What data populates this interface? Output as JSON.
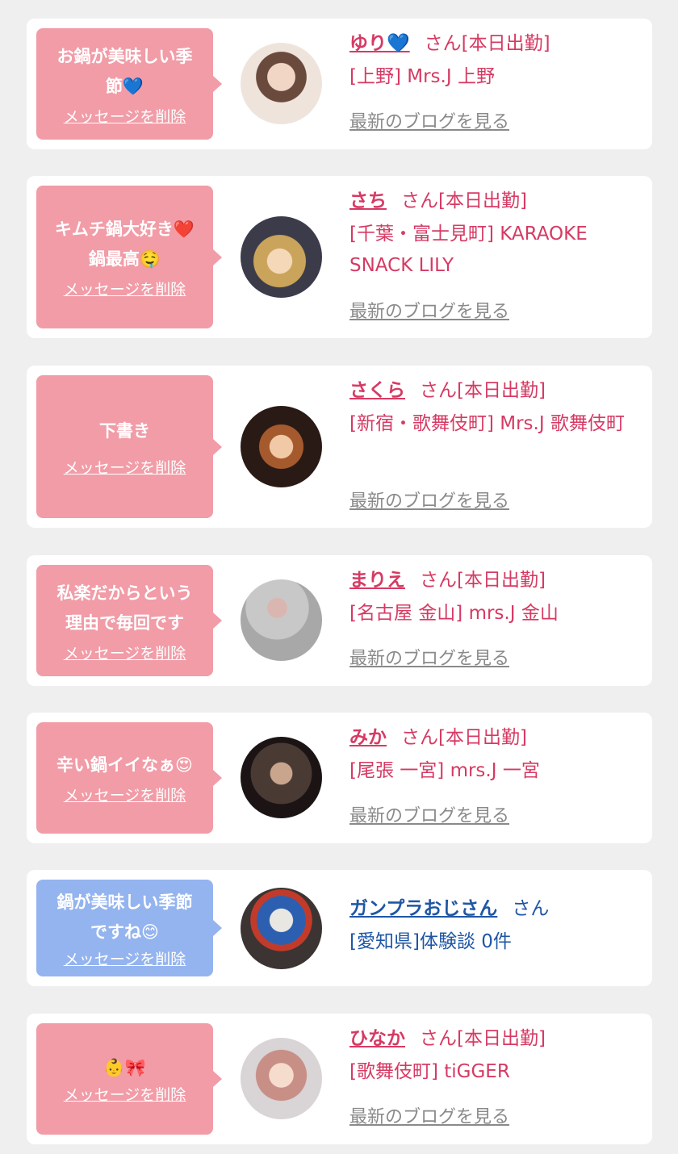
{
  "colors": {
    "pink": "#f19ca7",
    "blue": "#94b4ef",
    "name_pink": "#d63a63",
    "name_blue": "#1f56a5",
    "link_gray": "#8a8a8a"
  },
  "cards": [
    {
      "message": "お鍋が美味しい季\n節💙",
      "delete": "メッセージを削除",
      "name": "ゆり💙",
      "suffix": "さん[本日出勤]",
      "shop": "[上野] Mrs.J 上野",
      "blog": "最新のブログを見る"
    },
    {
      "message": "キムチ鍋大好き❤️\n鍋最高🤤",
      "delete": "メッセージを削除",
      "name": "さち",
      "suffix": "さん[本日出勤]",
      "shop": "[千葉・富士見町] KARAOKE SNACK LILY",
      "blog": "最新のブログを見る"
    },
    {
      "message": "下書き",
      "delete": "メッセージを削除",
      "name": "さくら",
      "suffix": "さん[本日出勤]",
      "shop": "[新宿・歌舞伎町] Mrs.J 歌舞伎町",
      "blog": "最新のブログを見る"
    },
    {
      "message": "私楽だからという\n理由で毎回です",
      "delete": "メッセージを削除",
      "name": "まりえ",
      "suffix": "さん[本日出勤]",
      "shop": "[名古屋 金山] mrs.J 金山",
      "blog": "最新のブログを見る"
    },
    {
      "message": "辛い鍋イイなぁ😍",
      "delete": "メッセージを削除",
      "name": "みか",
      "suffix": "さん[本日出勤]",
      "shop": "[尾張 一宮] mrs.J 一宮",
      "blog": "最新のブログを見る"
    },
    {
      "message": "鍋が美味しい季節\nですね😊",
      "delete": "メッセージを削除",
      "name": "ガンプラおじさん",
      "suffix": "さん",
      "shop": "[愛知県]体験談 0件",
      "blog": ""
    },
    {
      "message": "👶🎀",
      "delete": "メッセージを削除",
      "name": "ひなか",
      "suffix": "さん[本日出勤]",
      "shop": "[歌舞伎町] tiGGER",
      "blog": "最新のブログを見る"
    }
  ]
}
